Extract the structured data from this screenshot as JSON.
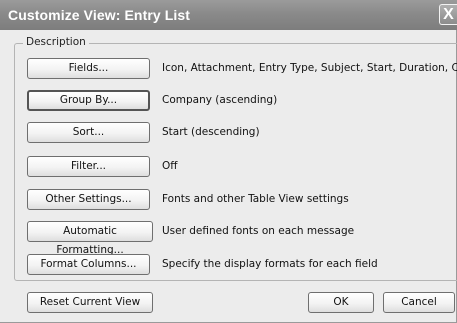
{
  "window": {
    "title": "Customize View: Entry List",
    "close_glyph": "X"
  },
  "group_label": "Description",
  "rows": [
    {
      "button": "Fields...",
      "description": "Icon, Attachment, Entry Type, Subject, Start, Duration, Co..."
    },
    {
      "button": "Group By...",
      "description": "Company (ascending)"
    },
    {
      "button": "Sort...",
      "description": "Start (descending)"
    },
    {
      "button": "Filter...",
      "description": "Off"
    },
    {
      "button": "Other Settings...",
      "description": "Fonts and other Table View settings"
    },
    {
      "button": "Automatic Formatting...",
      "description": "User defined fonts on each message"
    },
    {
      "button": "Format Columns...",
      "description": "Specify the display formats for each field"
    }
  ],
  "footer": {
    "reset": "Reset Current View",
    "ok": "OK",
    "cancel": "Cancel"
  },
  "icons": {
    "close": "close-icon"
  },
  "colors": {
    "titlebar": "#8a8a8a",
    "dialog_bg": "#ececec",
    "title_text": "#ffffff"
  }
}
